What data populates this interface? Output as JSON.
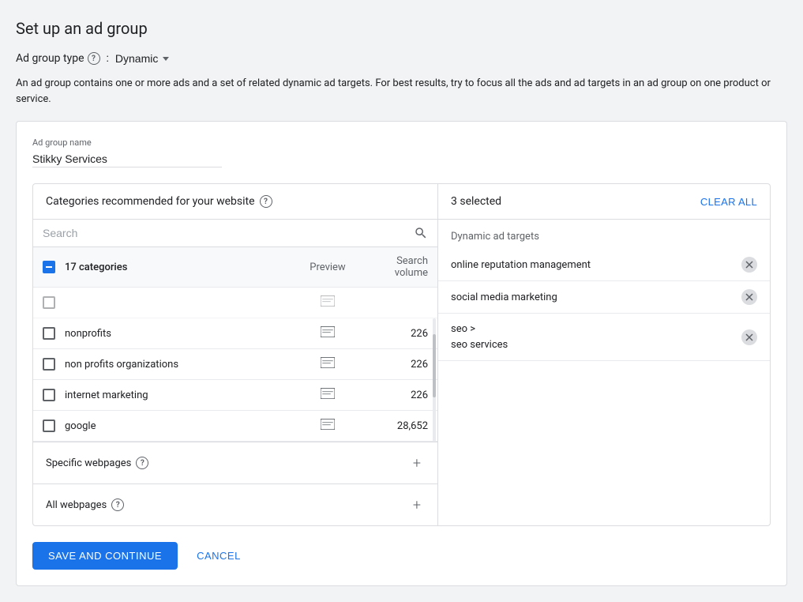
{
  "page": {
    "title": "Set up an ad group"
  },
  "adGroupType": {
    "label": "Ad group type",
    "help": "?",
    "colon": ":",
    "value": "Dynamic"
  },
  "description": "An ad group contains one or more ads and a set of related dynamic ad targets. For best results, try to focus all the ads and ad targets in an ad group on one product or service.",
  "adGroupName": {
    "label": "Ad group name",
    "value": "Stikky Services",
    "placeholder": "Ad group name"
  },
  "categoriesPanel": {
    "header": "Categories recommended for your website",
    "searchPlaceholder": "Search",
    "headerAll": "17 categories",
    "columnPreview": "Preview",
    "columnVolume": "Search volume",
    "rows": [
      {
        "name": "nonprofits",
        "volume": "226"
      },
      {
        "name": "non profits organizations",
        "volume": "226"
      },
      {
        "name": "internet marketing",
        "volume": "226"
      },
      {
        "name": "google",
        "volume": "28,652"
      }
    ]
  },
  "rightPanel": {
    "selectedCount": "3 selected",
    "clearAll": "CLEAR ALL",
    "dynamicTargetsLabel": "Dynamic ad targets",
    "targets": [
      {
        "id": 1,
        "name": "online reputation management"
      },
      {
        "id": 2,
        "name": "social media marketing"
      },
      {
        "id": 3,
        "name": "seo >\nseo services"
      }
    ]
  },
  "specificWebpages": {
    "label": "Specific webpages",
    "help": "?"
  },
  "allWebpages": {
    "label": "All webpages",
    "help": "?"
  },
  "actions": {
    "saveAndContinue": "SAVE AND CONTINUE",
    "cancel": "CANCEL"
  }
}
